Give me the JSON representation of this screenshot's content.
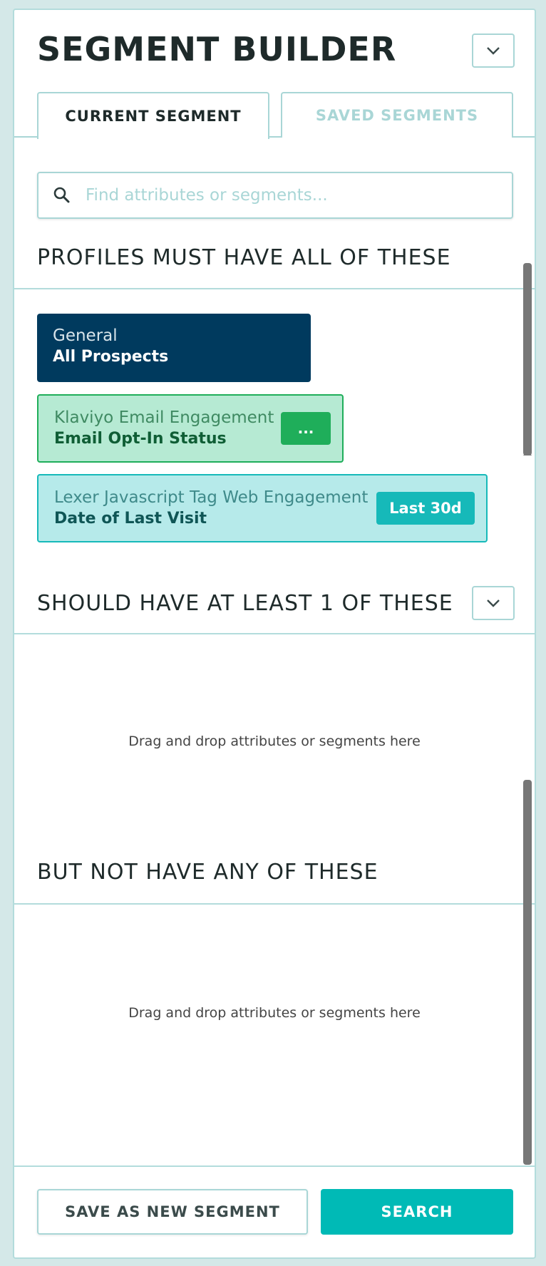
{
  "header": {
    "title": "SEGMENT BUILDER"
  },
  "tabs": [
    {
      "label": "CURRENT SEGMENT",
      "active": true
    },
    {
      "label": "SAVED SEGMENTS",
      "active": false
    }
  ],
  "search": {
    "placeholder": "Find attributes or segments...",
    "value": ""
  },
  "sections": {
    "must": {
      "title": "PROFILES MUST HAVE ALL OF THESE",
      "items": [
        {
          "category": "General",
          "attribute": "All Prospects"
        },
        {
          "category": "Klaviyo Email Engagement",
          "attribute": "Email Opt-In Status",
          "pill": "..."
        },
        {
          "category": "Lexer Javascript Tag Web Engagement",
          "attribute": "Date of Last Visit",
          "pill": "Last 30d"
        }
      ]
    },
    "should": {
      "title": "SHOULD HAVE AT LEAST 1 OF THESE",
      "drop_hint": "Drag and drop attributes or segments here"
    },
    "must_not": {
      "title": "BUT NOT HAVE ANY OF THESE",
      "drop_hint": "Drag and drop attributes or segments here"
    }
  },
  "footer": {
    "save_label": "SAVE AS NEW SEGMENT",
    "search_label": "SEARCH"
  },
  "colors": {
    "background": "#d4e8e8",
    "border": "#a9d6d6",
    "general_card": "#003a5e",
    "klaviyo_card": "#b6ead3",
    "klaviyo_accent": "#1fae5a",
    "lexer_card": "#b6eaea",
    "lexer_accent": "#16b9b9",
    "primary_button": "#00bab6"
  }
}
